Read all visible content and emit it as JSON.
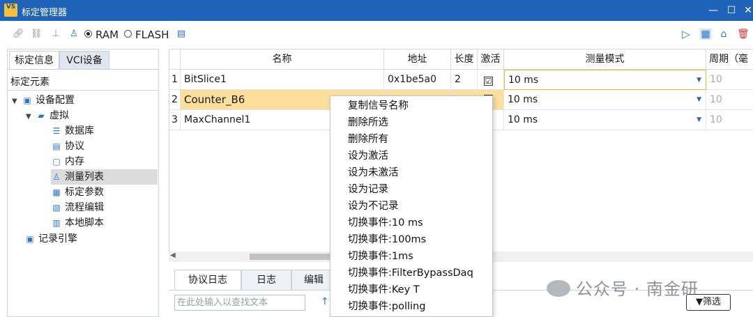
{
  "window": {
    "title": "标定管理器",
    "logo_text": "VS",
    "minimize": "—",
    "maximize": "☐",
    "close": "✕"
  },
  "toolbar": {
    "icons": [
      "link-icon",
      "unlink-icon",
      "stamp-icon",
      "user-stamp-icon",
      "memory-icon"
    ],
    "mode": {
      "ram_label": "RAM",
      "flash_label": "FLASH",
      "selected": "RAM"
    },
    "right_icons": [
      "play-icon",
      "layout-icon",
      "bookmark-icon",
      "delete-icon"
    ]
  },
  "left_panel": {
    "tabs": [
      {
        "label": "标定信息",
        "active": true
      },
      {
        "label": "VCI设备",
        "active": false
      }
    ],
    "section_label": "标定元素",
    "tree": [
      {
        "label": "设备配置",
        "icon": "config-icon",
        "level": 0,
        "expanded": true
      },
      {
        "label": "虚拟",
        "icon": "device-icon",
        "level": 1,
        "expanded": true
      },
      {
        "label": "数据库",
        "icon": "database-icon",
        "level": 2
      },
      {
        "label": "协议",
        "icon": "protocol-icon",
        "level": 2
      },
      {
        "label": "内存",
        "icon": "memory-icon",
        "level": 2
      },
      {
        "label": "测量列表",
        "icon": "measure-list-icon",
        "level": 2,
        "selected": true
      },
      {
        "label": "标定参数",
        "icon": "param-icon",
        "level": 2
      },
      {
        "label": "流程编辑",
        "icon": "flow-icon",
        "level": 2
      },
      {
        "label": "本地脚本",
        "icon": "script-icon",
        "level": 2
      },
      {
        "label": "记录引擎",
        "icon": "record-icon",
        "level": 0
      }
    ]
  },
  "grid": {
    "columns": [
      "",
      "名称",
      "地址",
      "长度",
      "激活",
      "测量模式",
      "周期（毫"
    ],
    "rows": [
      {
        "num": "1",
        "name": "BitSlice1",
        "address": "0x1be5a0",
        "length": "2",
        "active": "☑",
        "mode": "10 ms",
        "period": "10"
      },
      {
        "num": "2",
        "name": "Counter_B6",
        "address": "",
        "length": "",
        "active": "",
        "mode": "10 ms",
        "period": "10",
        "selected": true
      },
      {
        "num": "3",
        "name": "MaxChannel1",
        "address": "",
        "length": "",
        "active": "",
        "mode": "10 ms",
        "period": "10"
      }
    ]
  },
  "bottom": {
    "tabs": [
      {
        "label": "协议日志",
        "active": true
      },
      {
        "label": "日志",
        "active": false
      },
      {
        "label": "编辑",
        "active": false
      }
    ],
    "search_placeholder": "在此处输入以查找文本",
    "filter_label": "筛选",
    "watermark": "公众号 · 南金研"
  },
  "context_menu": {
    "items": [
      "复制信号名称",
      "删除所选",
      "删除所有",
      "设为激活",
      "设为未激活",
      "设为记录",
      "设为不记录",
      "切换事件:10 ms",
      "切换事件:100ms",
      "切换事件:1ms",
      "切换事件:FilterBypassDaq",
      "切换事件:Key T",
      "切换事件:polling"
    ]
  },
  "colors": {
    "title_bar": "#1f63b8",
    "selected_row": "#fddf9c",
    "accent": "#2e73c9"
  }
}
